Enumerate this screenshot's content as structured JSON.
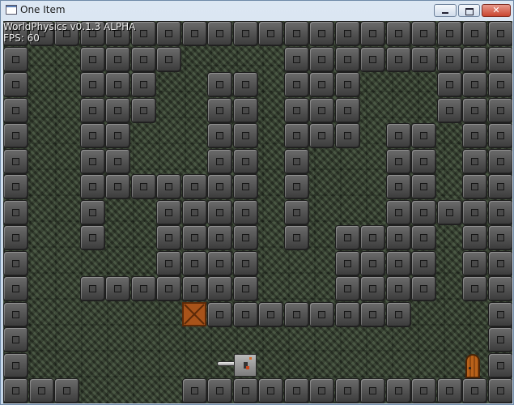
{
  "window": {
    "title": "One Item",
    "minimize_label": "",
    "maximize_label": "",
    "close_label": "✕"
  },
  "hud": {
    "version": "WorldPhysics v0.1.3 ALPHA",
    "fps_label": "FPS:",
    "fps": "60"
  },
  "icons": {
    "app": "window-icon",
    "crate": "crate-icon",
    "door": "door-icon",
    "player": "player-icon",
    "gun": "gun-icon"
  },
  "colors": {
    "tile": "#555555",
    "crate": "#a8531a",
    "door": "#b8611a",
    "background": "#3a4434"
  },
  "map": [
    "XXXXXXXXXXXXXXXXXXXX",
    "X..XXXX....XXXXXXXXX",
    "X..XXX..XX.XXX...XXX",
    "X..XXX..XX.XXX...XXX",
    "X..XX...XX.XXX.XX.XX",
    "X..XX...XX.X...XX.XX",
    "X..XXXXXXX.X...XX.XX",
    "X..X..XXXX.X...XXXXX",
    "X..X..XXXX.X.XXXX.XX",
    "X.....XXXX...XXXX.XX",
    "X..XXXXXXX...XXXX.XX",
    "X......CXXXXXXXX...X",
    "X..................X",
    "X..................X",
    "XXX....XXXXXXXXXXXXX"
  ],
  "objects": {
    "crate": {
      "col": 7,
      "row": 11
    },
    "door": {
      "col": 18,
      "row": 13
    },
    "player": {
      "col": 9,
      "row": 13
    }
  }
}
